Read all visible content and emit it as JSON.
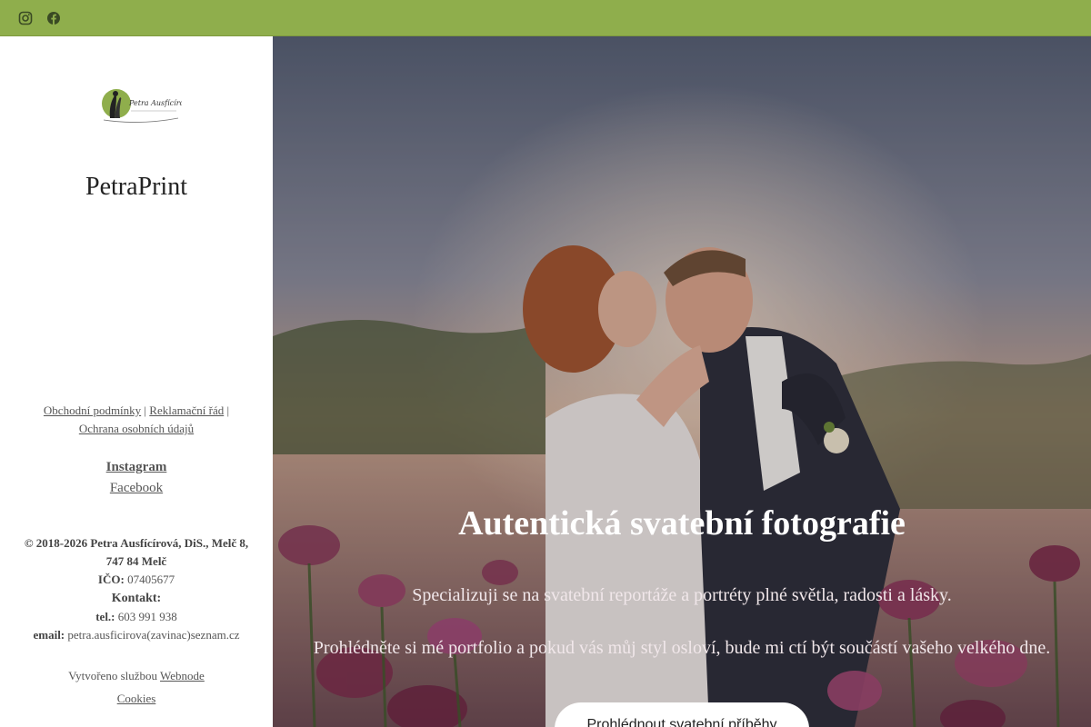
{
  "topbar": {
    "icons": [
      "instagram-icon",
      "facebook-icon"
    ],
    "color": "#8fae4c"
  },
  "sidebar": {
    "brand_name": "PetraPrint",
    "legal_links": [
      "Obchodní podmínky",
      "Reklamační řád",
      "Ochrana osobních údajů"
    ],
    "social_links": [
      "Instagram",
      "Facebook"
    ],
    "copyright": "© 2018-2026 Petra Ausfícírová, DiS., Melč 8, 747 84 Melč",
    "ico_label": "IČO:",
    "ico_value": "07405677",
    "contact_label": "Kontakt:",
    "tel_label": "tel.:",
    "tel_value": "603 991 938",
    "email_label": "email:",
    "email_value": "petra.ausficirova(zavinac)seznam.cz",
    "made_with_prefix": "Vytvořeno službou",
    "made_with_link": "Webnode",
    "cookies_link": "Cookies"
  },
  "hero": {
    "title": "Autentická svatební fotografie",
    "subtitle": "Specializuji se na svatební reportáže a portréty plné světla, radosti a lásky.",
    "subtitle2": "Prohlédněte si mé portfolio a pokud vás můj styl osloví, bude mi ctí být součástí vašeho velkého dne.",
    "cta_label": "Prohlédnout svatební příběhy"
  }
}
